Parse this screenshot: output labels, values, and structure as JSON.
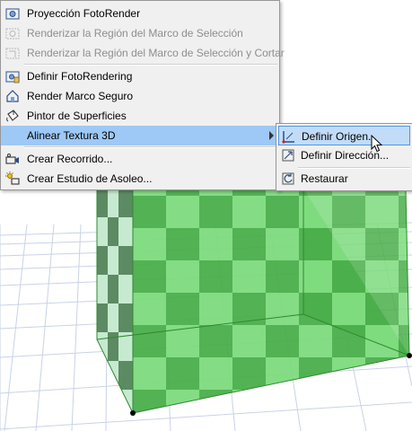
{
  "main_menu": {
    "items": [
      {
        "label": "Proyección FotoRender",
        "icon": "render-icon",
        "disabled": false
      },
      {
        "label": "Renderizar la Región del Marco de Selección",
        "icon": "render-region-icon",
        "disabled": true
      },
      {
        "label": "Renderizar la Región del Marco de Selección y Cortar",
        "icon": "render-crop-icon",
        "disabled": true
      },
      {
        "label": "Definir FotoRendering",
        "icon": "render-settings-icon",
        "disabled": false
      },
      {
        "label": "Render Marco Seguro",
        "icon": "safe-frame-icon",
        "disabled": false
      },
      {
        "label": "Pintor de Superficies",
        "icon": "paint-bucket-icon",
        "disabled": false
      },
      {
        "label": "Alinear Textura 3D",
        "icon": "",
        "disabled": false,
        "highlighted": true
      },
      {
        "label": "Crear Recorrido...",
        "icon": "camera-path-icon",
        "disabled": false
      },
      {
        "label": "Crear Estudio de Asoleo...",
        "icon": "sun-study-icon",
        "disabled": false
      }
    ]
  },
  "sub_menu": {
    "items": [
      {
        "label": "Definir Origen...",
        "icon": "set-origin-icon",
        "hovered": true
      },
      {
        "label": "Definir Dirección...",
        "icon": "set-direction-icon"
      },
      {
        "label": "Restaurar",
        "icon": "reset-icon"
      }
    ]
  },
  "colors": {
    "checker_light": "#7fdc7f",
    "checker_dark": "#4aae4a",
    "grid": "#c9d2e6",
    "highlight": "#9ec8f5"
  }
}
